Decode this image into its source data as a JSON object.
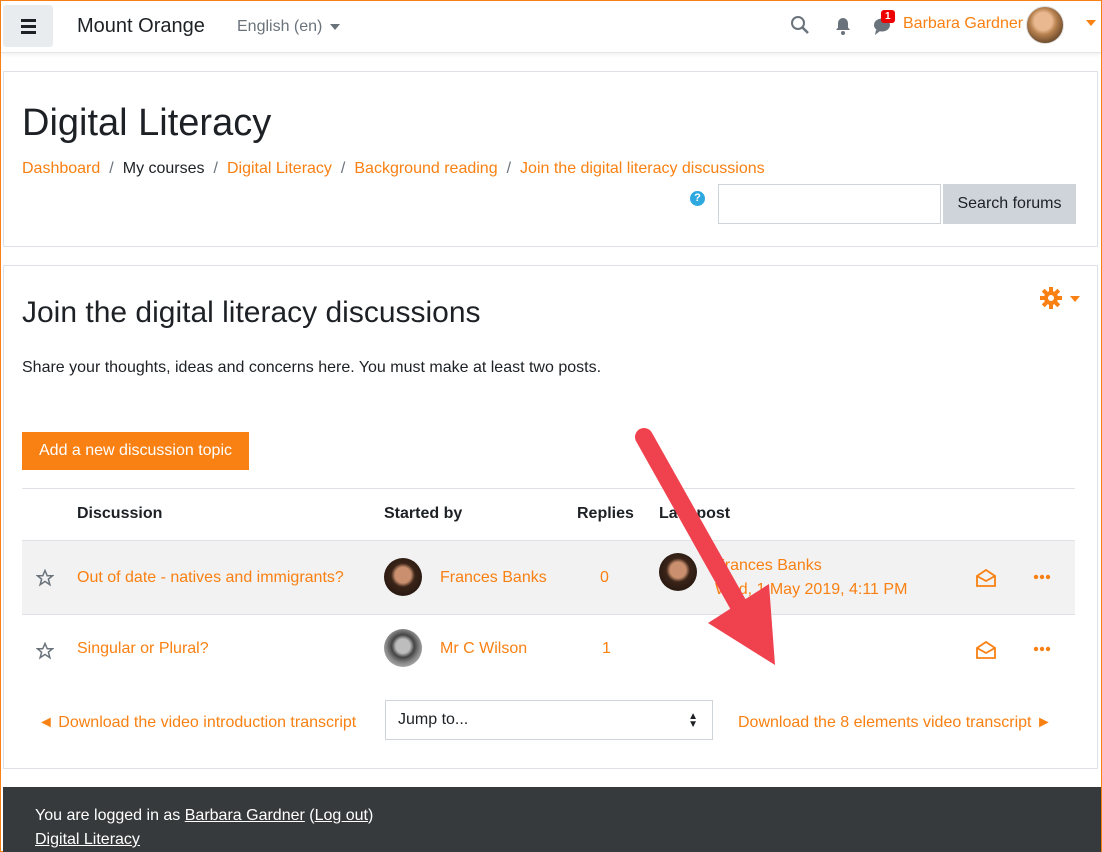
{
  "navbar": {
    "site_name": "Mount Orange",
    "language": "English (en)",
    "notification_count": "1",
    "user_name": "Barbara Gardner"
  },
  "header": {
    "title": "Digital Literacy",
    "breadcrumb": [
      "Dashboard",
      "My courses",
      "Digital Literacy",
      "Background reading",
      "Join the digital literacy discussions"
    ],
    "search_placeholder": "",
    "search_button": "Search forums",
    "help_glyph": "?"
  },
  "forum": {
    "title": "Join the digital literacy discussions",
    "intro": "Share your thoughts, ideas and concerns here. You must make at least two posts.",
    "add_button": "Add a new discussion topic",
    "columns": {
      "discussion": "Discussion",
      "started_by": "Started by",
      "replies": "Replies",
      "last_post": "Last post"
    },
    "rows": [
      {
        "title": "Out of date - natives and immigrants?",
        "started_by": "Frances Banks",
        "replies": "0",
        "last_post_name": "Frances Banks",
        "last_post_date": "Wed, 1 May 2019, 4:11 PM"
      },
      {
        "title": "Singular or Plural?",
        "started_by": "Mr C Wilson",
        "replies": "1",
        "last_post_name": "",
        "last_post_date": ""
      }
    ],
    "prev_link": "◄ Download the video introduction transcript",
    "jump_select": "Jump to...",
    "next_link": "Download the 8 elements video transcript ►"
  },
  "footer": {
    "logged_in_prefix": "You are logged in as ",
    "user": "Barbara Gardner",
    "logout": "Log out",
    "course": "Digital Literacy"
  },
  "colors": {
    "accent": "#f98012",
    "annotation_arrow": "#f0414e",
    "footer_bg": "#373a3c"
  },
  "icons": {
    "menu": "hamburger-icon",
    "search": "search-icon",
    "notifications": "bell-icon",
    "messages": "chat-icon",
    "settings": "gear-icon",
    "favourite": "star-icon",
    "subscribe": "envelope-open-icon",
    "actions": "ellipsis-icon",
    "annotation": "arrow-icon"
  }
}
